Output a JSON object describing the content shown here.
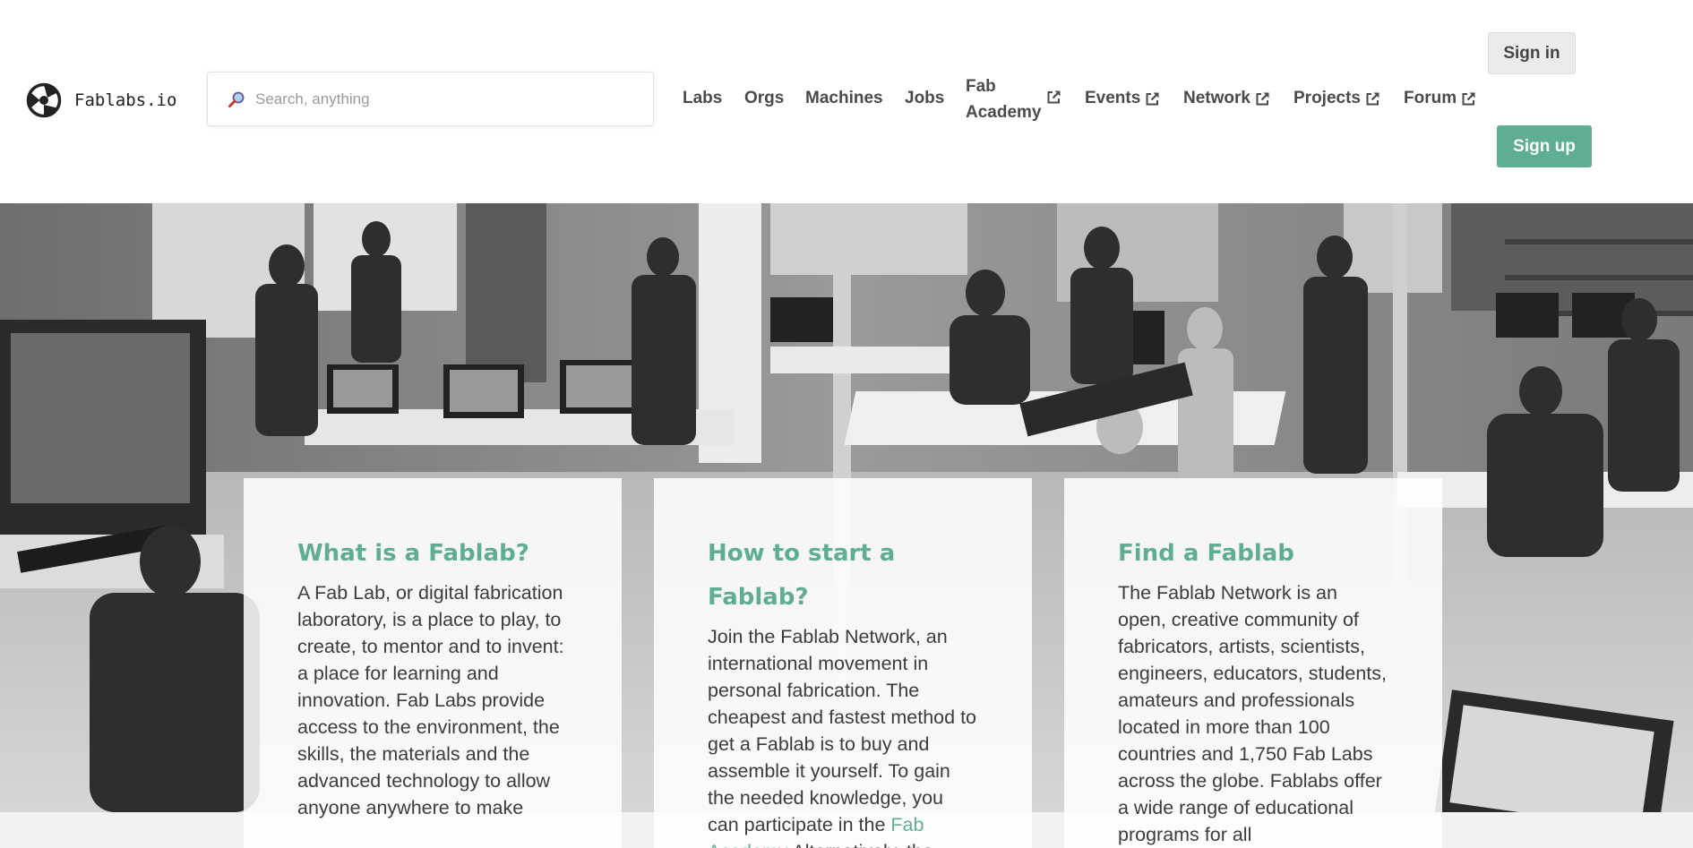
{
  "header": {
    "logo_text": "Fablabs.io",
    "search_placeholder": "Search, anything",
    "nav": {
      "labs": "Labs",
      "orgs": "Orgs",
      "machines": "Machines",
      "jobs": "Jobs",
      "fab_academy": "Fab Academy",
      "events": "Events",
      "network": "Network",
      "projects": "Projects",
      "forum": "Forum"
    },
    "sign_in": "Sign in",
    "sign_up": "Sign up"
  },
  "cards": {
    "what": {
      "title": "What is a Fablab?",
      "body": "A Fab Lab, or digital fabrication laboratory, is a place to play, to create, to mentor and to invent: a place for learning and innovation. Fab Labs provide access to the environment, the skills, the materials and the advanced technology to allow anyone anywhere to make"
    },
    "how": {
      "title": "How to start a Fablab?",
      "body_start": "Join the Fablab Network, an international movement in personal fabrication. The cheapest and fastest method to get a Fablab is to buy and assemble it yourself. To gain the needed knowledge, you can participate in the ",
      "link": "Fab Academy",
      "body_end": " Alternatively, the"
    },
    "find": {
      "title": "Find a Fablab",
      "body": "The Fablab Network is an open, creative community of fabricators, artists, scientists, engineers, educators, students, amateurs and professionals located in more than 100 countries and 1,750 Fab Labs across the globe. Fablabs offer a wide range of educational programs for all"
    }
  },
  "colors": {
    "accent": "#5fad95",
    "sign_in_bg": "#ebebeb",
    "header_bg": "#ffffff",
    "page_bg": "#f2f2f2"
  },
  "icons": {
    "logo": "fablab-logo-icon",
    "search": "search-icon",
    "external": "external-link-icon"
  }
}
